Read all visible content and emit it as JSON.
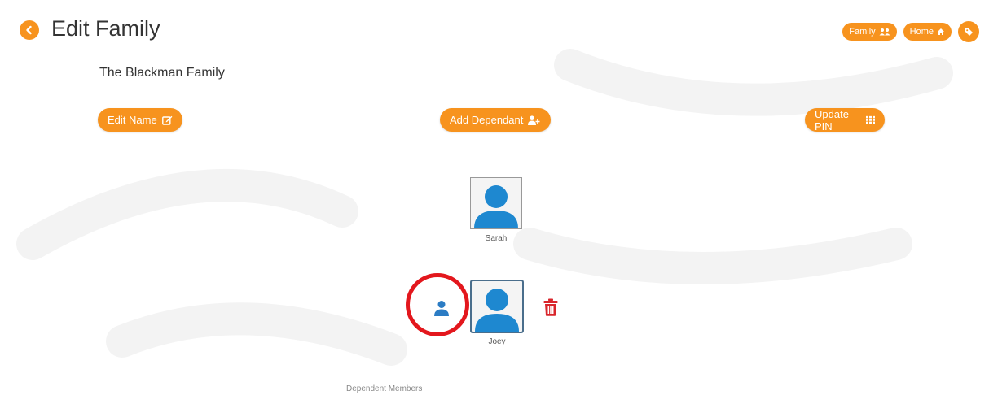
{
  "header": {
    "title": "Edit Family",
    "actions": [
      {
        "label": "Family",
        "icon": "users-icon"
      },
      {
        "label": "Home",
        "icon": "home-icon"
      },
      {
        "icon": "tag-icon"
      }
    ]
  },
  "family": {
    "name": "The Blackman Family"
  },
  "buttons": {
    "edit_name": "Edit Name",
    "add_dependant": "Add Dependant",
    "update_pin": "Update PIN"
  },
  "members": [
    {
      "name": "Sarah"
    },
    {
      "name": "Joey"
    }
  ],
  "footer": {
    "section_label": "Dependent Members"
  },
  "colors": {
    "accent": "#f7931e",
    "avatar_blue": "#1e88d0",
    "delete_red": "#d9262c",
    "highlight_red": "#e3171d"
  }
}
